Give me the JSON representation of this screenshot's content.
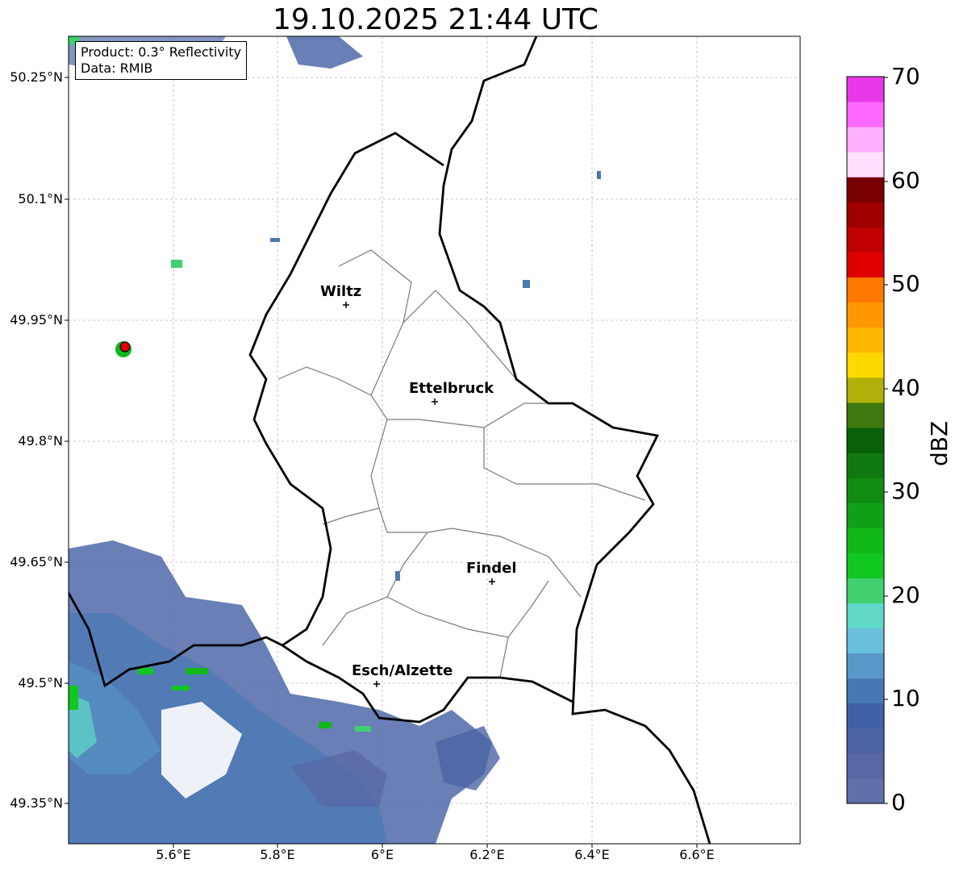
{
  "title": "19.10.2025 21:44 UTC",
  "info": {
    "product": "Product: 0.3° Reflectivity",
    "data": "Data: RMIB"
  },
  "lat_labels": [
    "50.25°N",
    "50.1°N",
    "49.95°N",
    "49.8°N",
    "49.65°N",
    "49.5°N",
    "49.35°N"
  ],
  "lon_labels": [
    "5.6°E",
    "5.8°E",
    "6°E",
    "6.2°E",
    "6.4°E",
    "6.6°E"
  ],
  "cities": [
    {
      "name": "Wiltz"
    },
    {
      "name": "Ettelbruck"
    },
    {
      "name": "Findel"
    },
    {
      "name": "Esch/Alzette"
    }
  ],
  "colorbar": {
    "label": "dBZ",
    "ticks": [
      "0",
      "10",
      "20",
      "30",
      "40",
      "50",
      "60",
      "70"
    ],
    "colors": [
      "#6070a8",
      "#5868a4",
      "#4c64a4",
      "#4060a8",
      "#4878b4",
      "#5898c8",
      "#68c0dc",
      "#60d8c8",
      "#40d070",
      "#10c820",
      "#10b818",
      "#10a018",
      "#108c10",
      "#107810",
      "#086008",
      "#407810",
      "#b0b008",
      "#ffd800",
      "#ffb800",
      "#ff9800",
      "#ff7800",
      "#e00000",
      "#c00000",
      "#a00000",
      "#780000",
      "#ffe0ff",
      "#ffb0ff",
      "#ff68ff",
      "#e838e8"
    ]
  }
}
